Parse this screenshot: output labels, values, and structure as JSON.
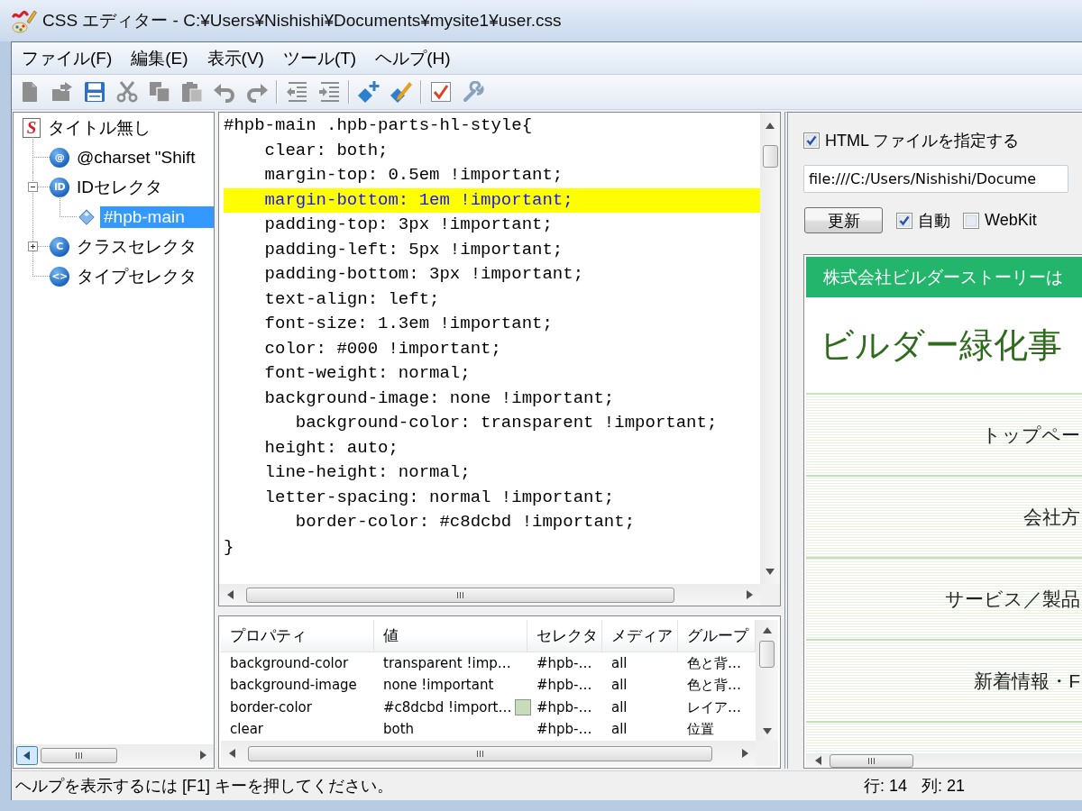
{
  "window": {
    "title": "CSS エディター - C:¥Users¥Nishishi¥Documents¥mysite1¥user.css"
  },
  "menu": [
    "ファイル(F)",
    "編集(E)",
    "表示(V)",
    "ツール(T)",
    "ヘルプ(H)"
  ],
  "toolbar": {
    "groups": [
      [
        {
          "kind": "new",
          "disabled": true
        },
        {
          "kind": "open",
          "disabled": true
        },
        {
          "kind": "save",
          "disabled": false
        },
        {
          "kind": "cut",
          "disabled": true
        },
        {
          "kind": "copy",
          "disabled": true
        },
        {
          "kind": "paste",
          "disabled": true
        },
        {
          "kind": "undo",
          "disabled": true
        },
        {
          "kind": "redo",
          "disabled": true
        }
      ],
      [
        {
          "kind": "outdent",
          "disabled": true
        },
        {
          "kind": "indent",
          "disabled": true
        }
      ],
      [
        {
          "kind": "add",
          "disabled": false
        },
        {
          "kind": "edit",
          "disabled": false
        }
      ],
      [
        {
          "kind": "check",
          "disabled": false
        },
        {
          "kind": "wrench",
          "disabled": false
        }
      ]
    ]
  },
  "tree": [
    {
      "label": "タイトル無し",
      "kind": "file",
      "icon_text": "S",
      "selected": false,
      "children": [
        {
          "label": "@charset \"Shift",
          "kind": "group",
          "icon_text": "@",
          "selected": false
        },
        {
          "label": "IDセレクタ",
          "kind": "group",
          "icon_text": "ID",
          "selected": false,
          "expanded": true,
          "children": [
            {
              "label": "#hpb-main",
              "kind": "rule",
              "selected": true
            }
          ]
        },
        {
          "label": "クラスセレクタ",
          "kind": "group",
          "icon_text": "C",
          "selected": false,
          "expanded": false
        },
        {
          "label": "タイプセレクタ",
          "kind": "group",
          "icon_text": "<>",
          "selected": false
        }
      ]
    }
  ],
  "editor": {
    "lines": [
      {
        "text": "#hpb-main .hpb-parts-hl-style{",
        "highlighted": false
      },
      {
        "text": "    clear: both;",
        "highlighted": false
      },
      {
        "text": "    margin-top: 0.5em !important;",
        "highlighted": false
      },
      {
        "text": "    margin-bottom: 1em !important;",
        "highlighted": true
      },
      {
        "text": "    padding-top: 3px !important;",
        "highlighted": false
      },
      {
        "text": "    padding-left: 5px !important;",
        "highlighted": false
      },
      {
        "text": "    padding-bottom: 3px !important;",
        "highlighted": false
      },
      {
        "text": "    text-align: left;",
        "highlighted": false
      },
      {
        "text": "    font-size: 1.3em !important;",
        "highlighted": false
      },
      {
        "text": "    color: #000 !important;",
        "highlighted": false
      },
      {
        "text": "    font-weight: normal;",
        "highlighted": false
      },
      {
        "text": "    background-image: none !important;",
        "highlighted": false
      },
      {
        "text": "       background-color: transparent !important;",
        "highlighted": false
      },
      {
        "text": "    height: auto;",
        "highlighted": false
      },
      {
        "text": "    line-height: normal;",
        "highlighted": false
      },
      {
        "text": "    letter-spacing: normal !important;",
        "highlighted": false
      },
      {
        "text": "       border-color: #c8dcbd !important;",
        "highlighted": false
      },
      {
        "text": "}",
        "highlighted": false
      }
    ]
  },
  "table": {
    "columns": [
      "プロパティ",
      "値",
      "セレクタ",
      "メディア",
      "グループ"
    ],
    "rows": [
      {
        "cells": [
          "background-color",
          "transparent !imp…",
          "#hpb-…",
          "all",
          "色と背…"
        ]
      },
      {
        "cells": [
          "background-image",
          "none !important",
          "#hpb-…",
          "all",
          "色と背…"
        ]
      },
      {
        "cells": [
          "border-color",
          "#c8dcbd !import…",
          "#hpb-…",
          "all",
          "レイア…"
        ],
        "color": "#c8dcbd"
      },
      {
        "cells": [
          "clear",
          "both",
          "#hpb-…",
          "all",
          "位置"
        ]
      }
    ]
  },
  "preview_panel": {
    "use_html_file": {
      "label": "HTML ファイルを指定する",
      "checked": true
    },
    "url": {
      "value": "file:///C:/Users/Nishishi/Docume"
    },
    "refresh_button": "更新",
    "options": [
      {
        "label": "自動",
        "checked": true
      },
      {
        "label": "WebKit",
        "checked": false
      }
    ],
    "page": {
      "banner": "株式会社ビルダーストーリーは",
      "heading": "ビルダー緑化事",
      "nav": [
        "トップペー",
        "会社方",
        "サービス／製品",
        "新着情報・F"
      ]
    }
  },
  "status_bar": {
    "message": "ヘルプを表示するには [F1] キーを押してください。",
    "line": "行: 14",
    "column": "列: 21"
  }
}
